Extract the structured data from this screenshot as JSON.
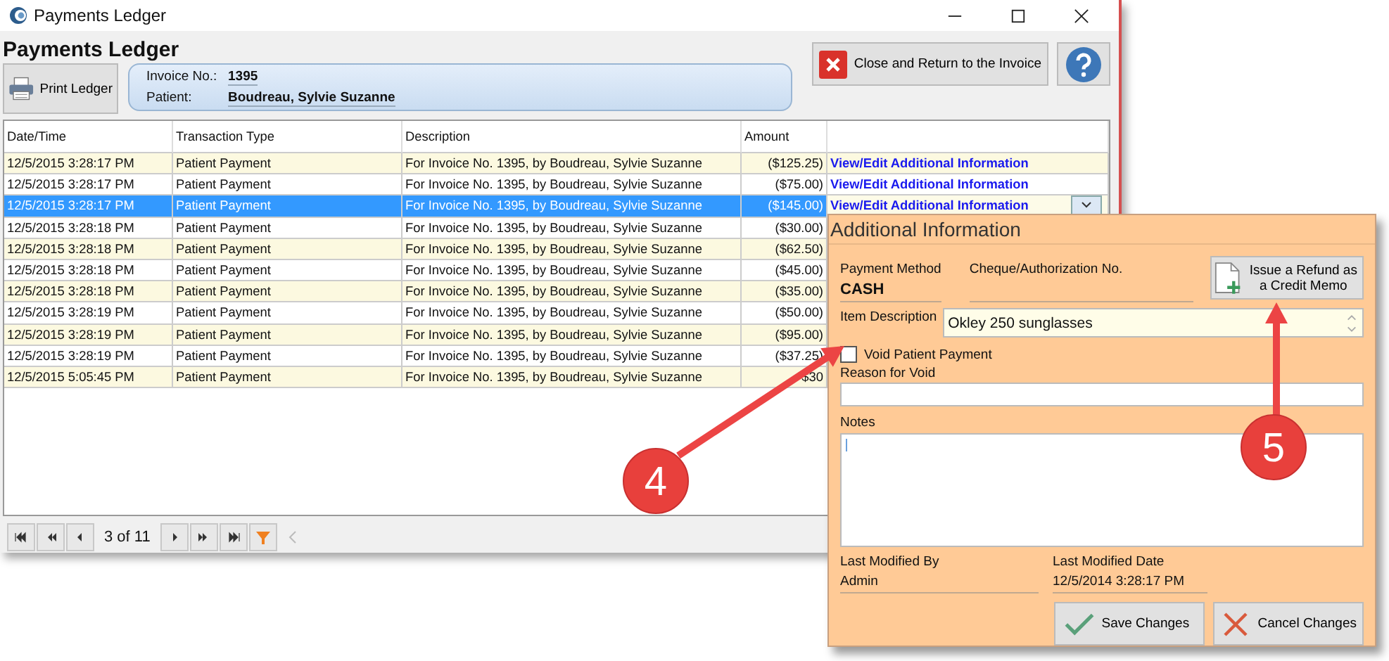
{
  "window": {
    "title": "Payments Ledger"
  },
  "header": {
    "title": "Payments Ledger",
    "print_button": "Print Ledger",
    "invoice": {
      "label": "Invoice No.:",
      "value": "1395"
    },
    "patient": {
      "label": "Patient:",
      "value": "Boudreau, Sylvie Suzanne"
    },
    "close_button": "Close and Return to the Invoice"
  },
  "table": {
    "columns": [
      "Date/Time",
      "Transaction Type",
      "Description",
      "Amount"
    ],
    "rows": [
      {
        "date": "12/5/2015 3:28:17 PM",
        "type": "Patient Payment",
        "description": "For Invoice No. 1395, by Boudreau, Sylvie Suzanne",
        "amount": "($125.25)",
        "link": "View/Edit Additional Information",
        "selected": false
      },
      {
        "date": "12/5/2015 3:28:17 PM",
        "type": "Patient Payment",
        "description": "For Invoice No. 1395, by Boudreau, Sylvie Suzanne",
        "amount": "($75.00)",
        "link": "View/Edit Additional Information",
        "selected": false
      },
      {
        "date": "12/5/2015 3:28:17 PM",
        "type": "Patient Payment",
        "description": "For Invoice No. 1395, by Boudreau, Sylvie Suzanne",
        "amount": "($145.00)",
        "link": "View/Edit Additional Information",
        "selected": true
      },
      {
        "date": "12/5/2015 3:28:18 PM",
        "type": "Patient Payment",
        "description": "For Invoice No. 1395, by Boudreau, Sylvie Suzanne",
        "amount": "($30.00)",
        "selected": false
      },
      {
        "date": "12/5/2015 3:28:18 PM",
        "type": "Patient Payment",
        "description": "For Invoice No. 1395, by Boudreau, Sylvie Suzanne",
        "amount": "($62.50)",
        "selected": false
      },
      {
        "date": "12/5/2015 3:28:18 PM",
        "type": "Patient Payment",
        "description": "For Invoice No. 1395, by Boudreau, Sylvie Suzanne",
        "amount": "($45.00)",
        "selected": false
      },
      {
        "date": "12/5/2015 3:28:18 PM",
        "type": "Patient Payment",
        "description": "For Invoice No. 1395, by Boudreau, Sylvie Suzanne",
        "amount": "($35.00)",
        "selected": false
      },
      {
        "date": "12/5/2015 3:28:19 PM",
        "type": "Patient Payment",
        "description": "For Invoice No. 1395, by Boudreau, Sylvie Suzanne",
        "amount": "($50.00)",
        "selected": false
      },
      {
        "date": "12/5/2015 3:28:19 PM",
        "type": "Patient Payment",
        "description": "For Invoice No. 1395, by Boudreau, Sylvie Suzanne",
        "amount": "($95.00)",
        "selected": false
      },
      {
        "date": "12/5/2015 3:28:19 PM",
        "type": "Patient Payment",
        "description": "For Invoice No. 1395, by Boudreau, Sylvie Suzanne",
        "amount": "($37.25)",
        "selected": false
      },
      {
        "date": "12/5/2015 5:05:45 PM",
        "type": "Patient Payment",
        "description": "For Invoice No. 1395, by Boudreau, Sylvie Suzanne",
        "amount": "$30",
        "selected": false
      }
    ]
  },
  "pager": {
    "position": "3 of 11"
  },
  "popup": {
    "title": "Additional Information",
    "payment_method": {
      "label": "Payment Method",
      "value": "CASH"
    },
    "cheque": {
      "label": "Cheque/Authorization No."
    },
    "refund_button": "Issue a Refund as a Credit Memo",
    "item_description": {
      "label": "Item Description",
      "value": "Okley 250 sunglasses"
    },
    "void": {
      "label": "Void Patient Payment",
      "checked": false
    },
    "reason": {
      "label": "Reason for Void"
    },
    "notes": {
      "label": "Notes"
    },
    "modified_by": {
      "label": "Last Modified By",
      "value": "Admin"
    },
    "modified_date": {
      "label": "Last Modified Date",
      "value": "12/5/2014 3:28:17 PM"
    },
    "buttons": [
      {
        "label": "Save Changes",
        "kind": "save"
      },
      {
        "label": "Cancel Changes",
        "kind": "cancel"
      }
    ]
  },
  "annotations": [
    {
      "label": "4"
    },
    {
      "label": "5"
    }
  ]
}
